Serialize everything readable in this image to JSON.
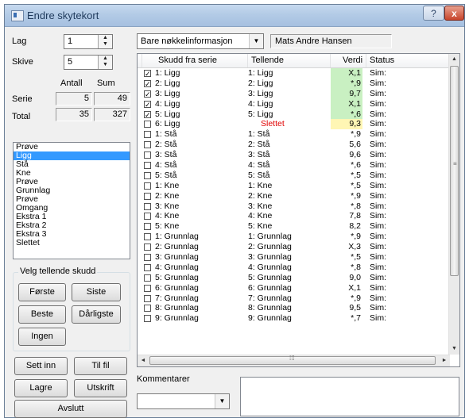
{
  "window": {
    "title": "Endre skytekort",
    "help_label": "?",
    "close_label": "x"
  },
  "left": {
    "lag_label": "Lag",
    "lag_value": "1",
    "skive_label": "Skive",
    "skive_value": "5",
    "antall_label": "Antall",
    "sum_label": "Sum",
    "serie_label": "Serie",
    "serie_antall": "5",
    "serie_sum": "49",
    "total_label": "Total",
    "total_antall": "35",
    "total_sum": "327",
    "list_items": [
      "Prøve",
      "Ligg",
      "Stå",
      "Kne",
      "Prøve",
      "Grunnlag",
      "Prøve",
      "Omgang",
      "Ekstra 1",
      "Ekstra 2",
      "Ekstra 3",
      "Slettet"
    ],
    "selected_index": 1
  },
  "group": {
    "label": "Velg tellende skudd",
    "forste": "Første",
    "siste": "Siste",
    "beste": "Beste",
    "darligste": "Dårligste",
    "ingen": "Ingen"
  },
  "bottom_buttons": {
    "sett_inn": "Sett inn",
    "til_fil": "Til fil",
    "lagre": "Lagre",
    "utskrift": "Utskrift",
    "avslutt": "Avslutt"
  },
  "top": {
    "filter_value": "Bare nøkkelinformasjon",
    "shooter_name": "Mats Andre Hansen"
  },
  "grid": {
    "headers": [
      "Skudd fra serie",
      "Tellende",
      "Verdi",
      "Status"
    ],
    "rows": [
      {
        "checked": true,
        "skudd": "1: Ligg",
        "tellende": "1: Ligg",
        "verdi": "X,1",
        "status": "Sim:",
        "hl": "green"
      },
      {
        "checked": true,
        "skudd": "2: Ligg",
        "tellende": "2: Ligg",
        "verdi": "*,9",
        "status": "Sim:",
        "hl": "green"
      },
      {
        "checked": true,
        "skudd": "3: Ligg",
        "tellende": "3: Ligg",
        "verdi": "9,7",
        "status": "Sim:",
        "hl": "green"
      },
      {
        "checked": true,
        "skudd": "4: Ligg",
        "tellende": "4: Ligg",
        "verdi": "X,1",
        "status": "Sim:",
        "hl": "green"
      },
      {
        "checked": true,
        "skudd": "5: Ligg",
        "tellende": "5: Ligg",
        "verdi": "*,6",
        "status": "Sim:",
        "hl": "green"
      },
      {
        "checked": false,
        "skudd": "6: Ligg",
        "tellende": "Slettet",
        "verdi": "9,3",
        "status": "Sim:",
        "hl": "yellow",
        "red": true
      },
      {
        "checked": false,
        "skudd": "1: Stå",
        "tellende": "1: Stå",
        "verdi": "*,9",
        "status": "Sim:"
      },
      {
        "checked": false,
        "skudd": "2: Stå",
        "tellende": "2: Stå",
        "verdi": "5,6",
        "status": "Sim:"
      },
      {
        "checked": false,
        "skudd": "3: Stå",
        "tellende": "3: Stå",
        "verdi": "9,6",
        "status": "Sim:"
      },
      {
        "checked": false,
        "skudd": "4: Stå",
        "tellende": "4: Stå",
        "verdi": "*,6",
        "status": "Sim:"
      },
      {
        "checked": false,
        "skudd": "5: Stå",
        "tellende": "5: Stå",
        "verdi": "*,5",
        "status": "Sim:"
      },
      {
        "checked": false,
        "skudd": "1: Kne",
        "tellende": "1: Kne",
        "verdi": "*,5",
        "status": "Sim:"
      },
      {
        "checked": false,
        "skudd": "2: Kne",
        "tellende": "2: Kne",
        "verdi": "*,9",
        "status": "Sim:"
      },
      {
        "checked": false,
        "skudd": "3: Kne",
        "tellende": "3: Kne",
        "verdi": "*,8",
        "status": "Sim:"
      },
      {
        "checked": false,
        "skudd": "4: Kne",
        "tellende": "4: Kne",
        "verdi": "7,8",
        "status": "Sim:"
      },
      {
        "checked": false,
        "skudd": "5: Kne",
        "tellende": "5: Kne",
        "verdi": "8,2",
        "status": "Sim:"
      },
      {
        "checked": false,
        "skudd": "1: Grunnlag",
        "tellende": "1: Grunnlag",
        "verdi": "*,9",
        "status": "Sim:"
      },
      {
        "checked": false,
        "skudd": "2: Grunnlag",
        "tellende": "2: Grunnlag",
        "verdi": "X,3",
        "status": "Sim:"
      },
      {
        "checked": false,
        "skudd": "3: Grunnlag",
        "tellende": "3: Grunnlag",
        "verdi": "*,5",
        "status": "Sim:"
      },
      {
        "checked": false,
        "skudd": "4: Grunnlag",
        "tellende": "4: Grunnlag",
        "verdi": "*,8",
        "status": "Sim:"
      },
      {
        "checked": false,
        "skudd": "5: Grunnlag",
        "tellende": "5: Grunnlag",
        "verdi": "9,0",
        "status": "Sim:"
      },
      {
        "checked": false,
        "skudd": "6: Grunnlag",
        "tellende": "6: Grunnlag",
        "verdi": "X,1",
        "status": "Sim:"
      },
      {
        "checked": false,
        "skudd": "7: Grunnlag",
        "tellende": "7: Grunnlag",
        "verdi": "*,9",
        "status": "Sim:"
      },
      {
        "checked": false,
        "skudd": "8: Grunnlag",
        "tellende": "8: Grunnlag",
        "verdi": "9,5",
        "status": "Sim:"
      },
      {
        "checked": false,
        "skudd": "9: Grunnlag",
        "tellende": "9: Grunnlag",
        "verdi": "*,7",
        "status": "Sim:"
      }
    ]
  },
  "comment": {
    "label": "Kommentarer",
    "combo_value": ""
  },
  "colors": {
    "green_highlight": "#c9f0c2",
    "yellow_highlight": "#fff6b4",
    "deleted_text": "#e00000",
    "selection": "#3399ff"
  },
  "icons": {
    "app": "window-icon",
    "spin": "spin-arrows-icon",
    "combo": "chevron-down-icon",
    "check": "check-icon"
  }
}
